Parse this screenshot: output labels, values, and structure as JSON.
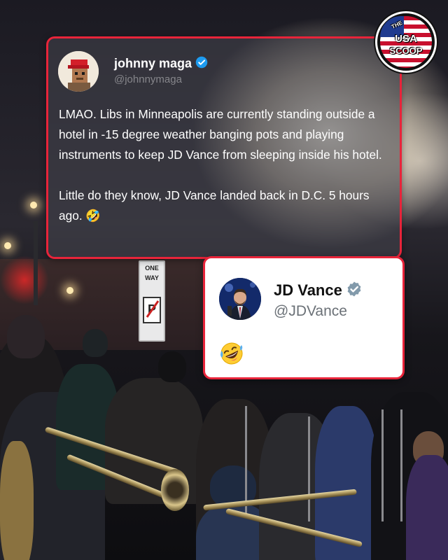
{
  "tweet1": {
    "name": "johnny maga",
    "handle": "@johnnymaga",
    "text_para1": "LMAO. Libs in Minneapolis are currently standing outside a hotel in -15 degree weather banging pots and playing instruments to keep JD Vance from sleeping inside his hotel.",
    "text_para2": "Little do they know, JD Vance landed back in D.C. 5 hours ago. 🤣",
    "verified": true
  },
  "tweet2": {
    "name": "JD Vance",
    "handle": "@JDVance",
    "text": "🤣",
    "verified": true
  },
  "logo": {
    "line1": "THE",
    "line2": "USA",
    "line3": "SCOOP"
  },
  "background": {
    "sign_text_1": "ONE",
    "sign_text_2": "WAY",
    "sign_letter": "P"
  },
  "colors": {
    "frame_red": "#e8243a",
    "verified_blue": "#1d9bf0"
  }
}
